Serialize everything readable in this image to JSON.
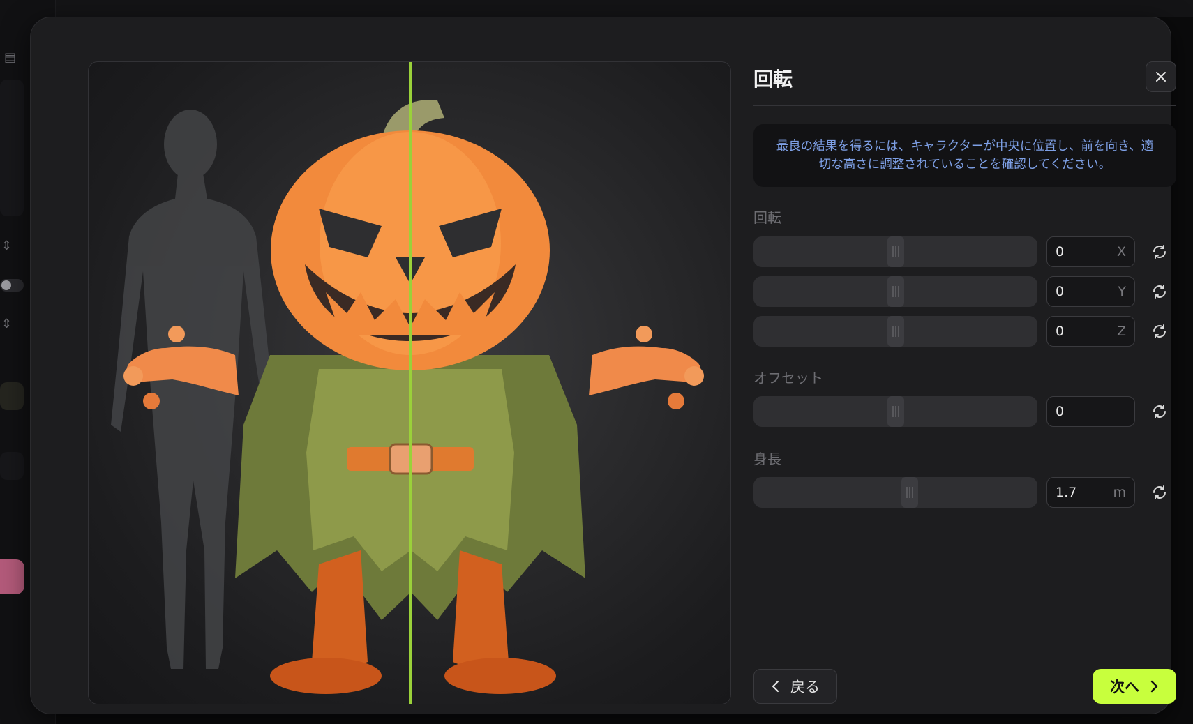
{
  "dialog": {
    "title": "回転",
    "close_icon": "close-icon",
    "notice": "最良の結果を得るには、キャラクターが中央に位置し、前を向き、適切な高さに調整されていることを確認してください。"
  },
  "rotation": {
    "label": "回転",
    "x": {
      "value": "0",
      "unit": "X",
      "slider_fraction": 0.5
    },
    "y": {
      "value": "0",
      "unit": "Y",
      "slider_fraction": 0.5
    },
    "z": {
      "value": "0",
      "unit": "Z",
      "slider_fraction": 0.5
    }
  },
  "offset": {
    "label": "オフセット",
    "value": "0",
    "slider_fraction": 0.5
  },
  "height": {
    "label": "身長",
    "value": "1.7",
    "unit": "m",
    "slider_fraction": 0.55
  },
  "footer": {
    "back_label": "戻る",
    "next_label": "次へ"
  },
  "colors": {
    "accent": "#c8ff3d",
    "center_line": "#9ad13a",
    "notice_text": "#7ea0e6"
  }
}
